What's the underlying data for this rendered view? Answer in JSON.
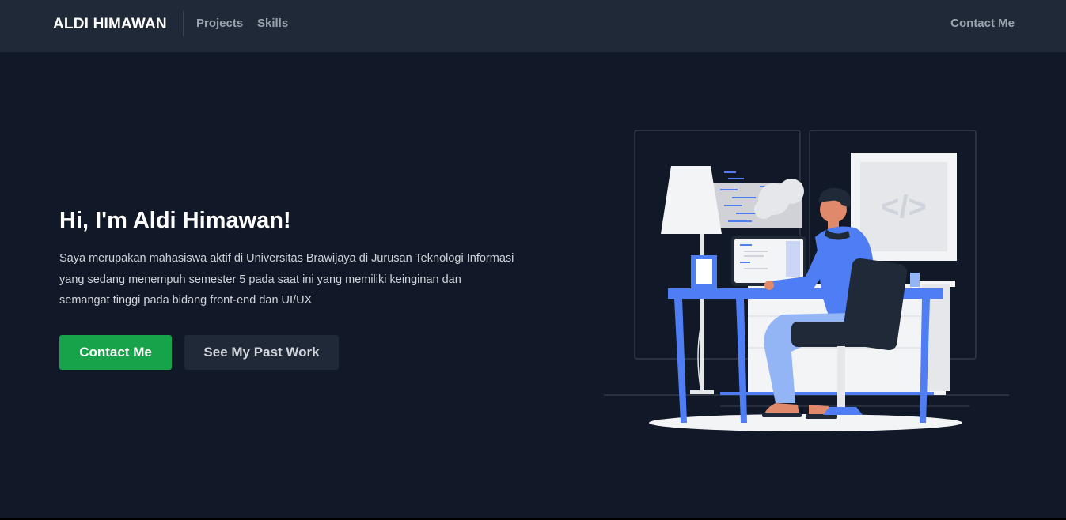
{
  "nav": {
    "brand": "ALDI HIMAWAN",
    "links": [
      {
        "label": "Projects"
      },
      {
        "label": "Skills"
      }
    ],
    "contact_label": "Contact Me"
  },
  "hero": {
    "title": "Hi, I'm Aldi Himawan!",
    "description": "Saya merupakan mahasiswa aktif di Universitas Brawijaya di Jurusan Teknologi Informasi yang sedang menempuh semester 5 pada saat ini yang memiliki keinginan dan semangat tinggi pada bidang front-end dan UI/UX",
    "primary_button": "Contact Me",
    "secondary_button": "See My Past Work",
    "code_symbol": "</>"
  },
  "colors": {
    "background": "#111827",
    "navbar": "#1f2937",
    "accent_green": "#16a34a",
    "illustration_blue": "#4f7df3"
  },
  "icons": {
    "illustration": "developer-at-desk-illustration"
  }
}
